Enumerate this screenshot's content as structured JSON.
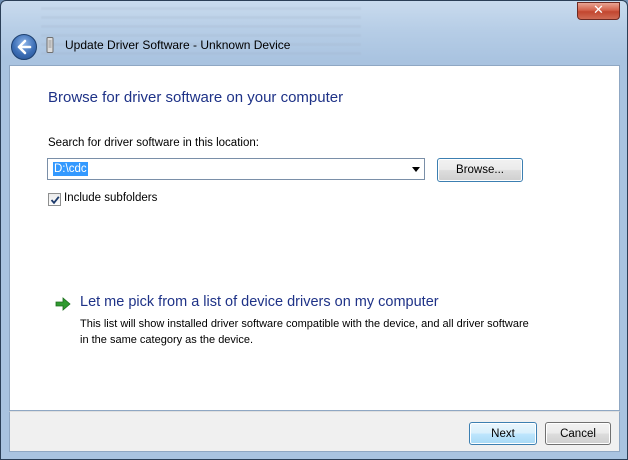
{
  "window": {
    "title": "Update Driver Software - Unknown Device",
    "close_symbol": "✕"
  },
  "content": {
    "heading": "Browse for driver software on your computer",
    "search_label": "Search for driver software in this location:",
    "search_path": "D:\\cdc",
    "browse_label": "Browse...",
    "include_subfolders_label": "Include subfolders",
    "include_subfolders_checked": true,
    "pick_title": "Let me pick from a list of device drivers on my computer",
    "pick_description": "This list will show installed driver software compatible with the device, and all driver software in the same category as the device."
  },
  "footer": {
    "next_label": "Next",
    "cancel_label": "Cancel"
  },
  "colors": {
    "heading": "#1e3287",
    "selection": "#3399ff",
    "arrow_green": "#2f9a2f"
  },
  "icons": {
    "back": "back-arrow-icon",
    "device": "device-icon",
    "pick": "green-arrow-icon",
    "checkbox": "checkmark-icon"
  }
}
